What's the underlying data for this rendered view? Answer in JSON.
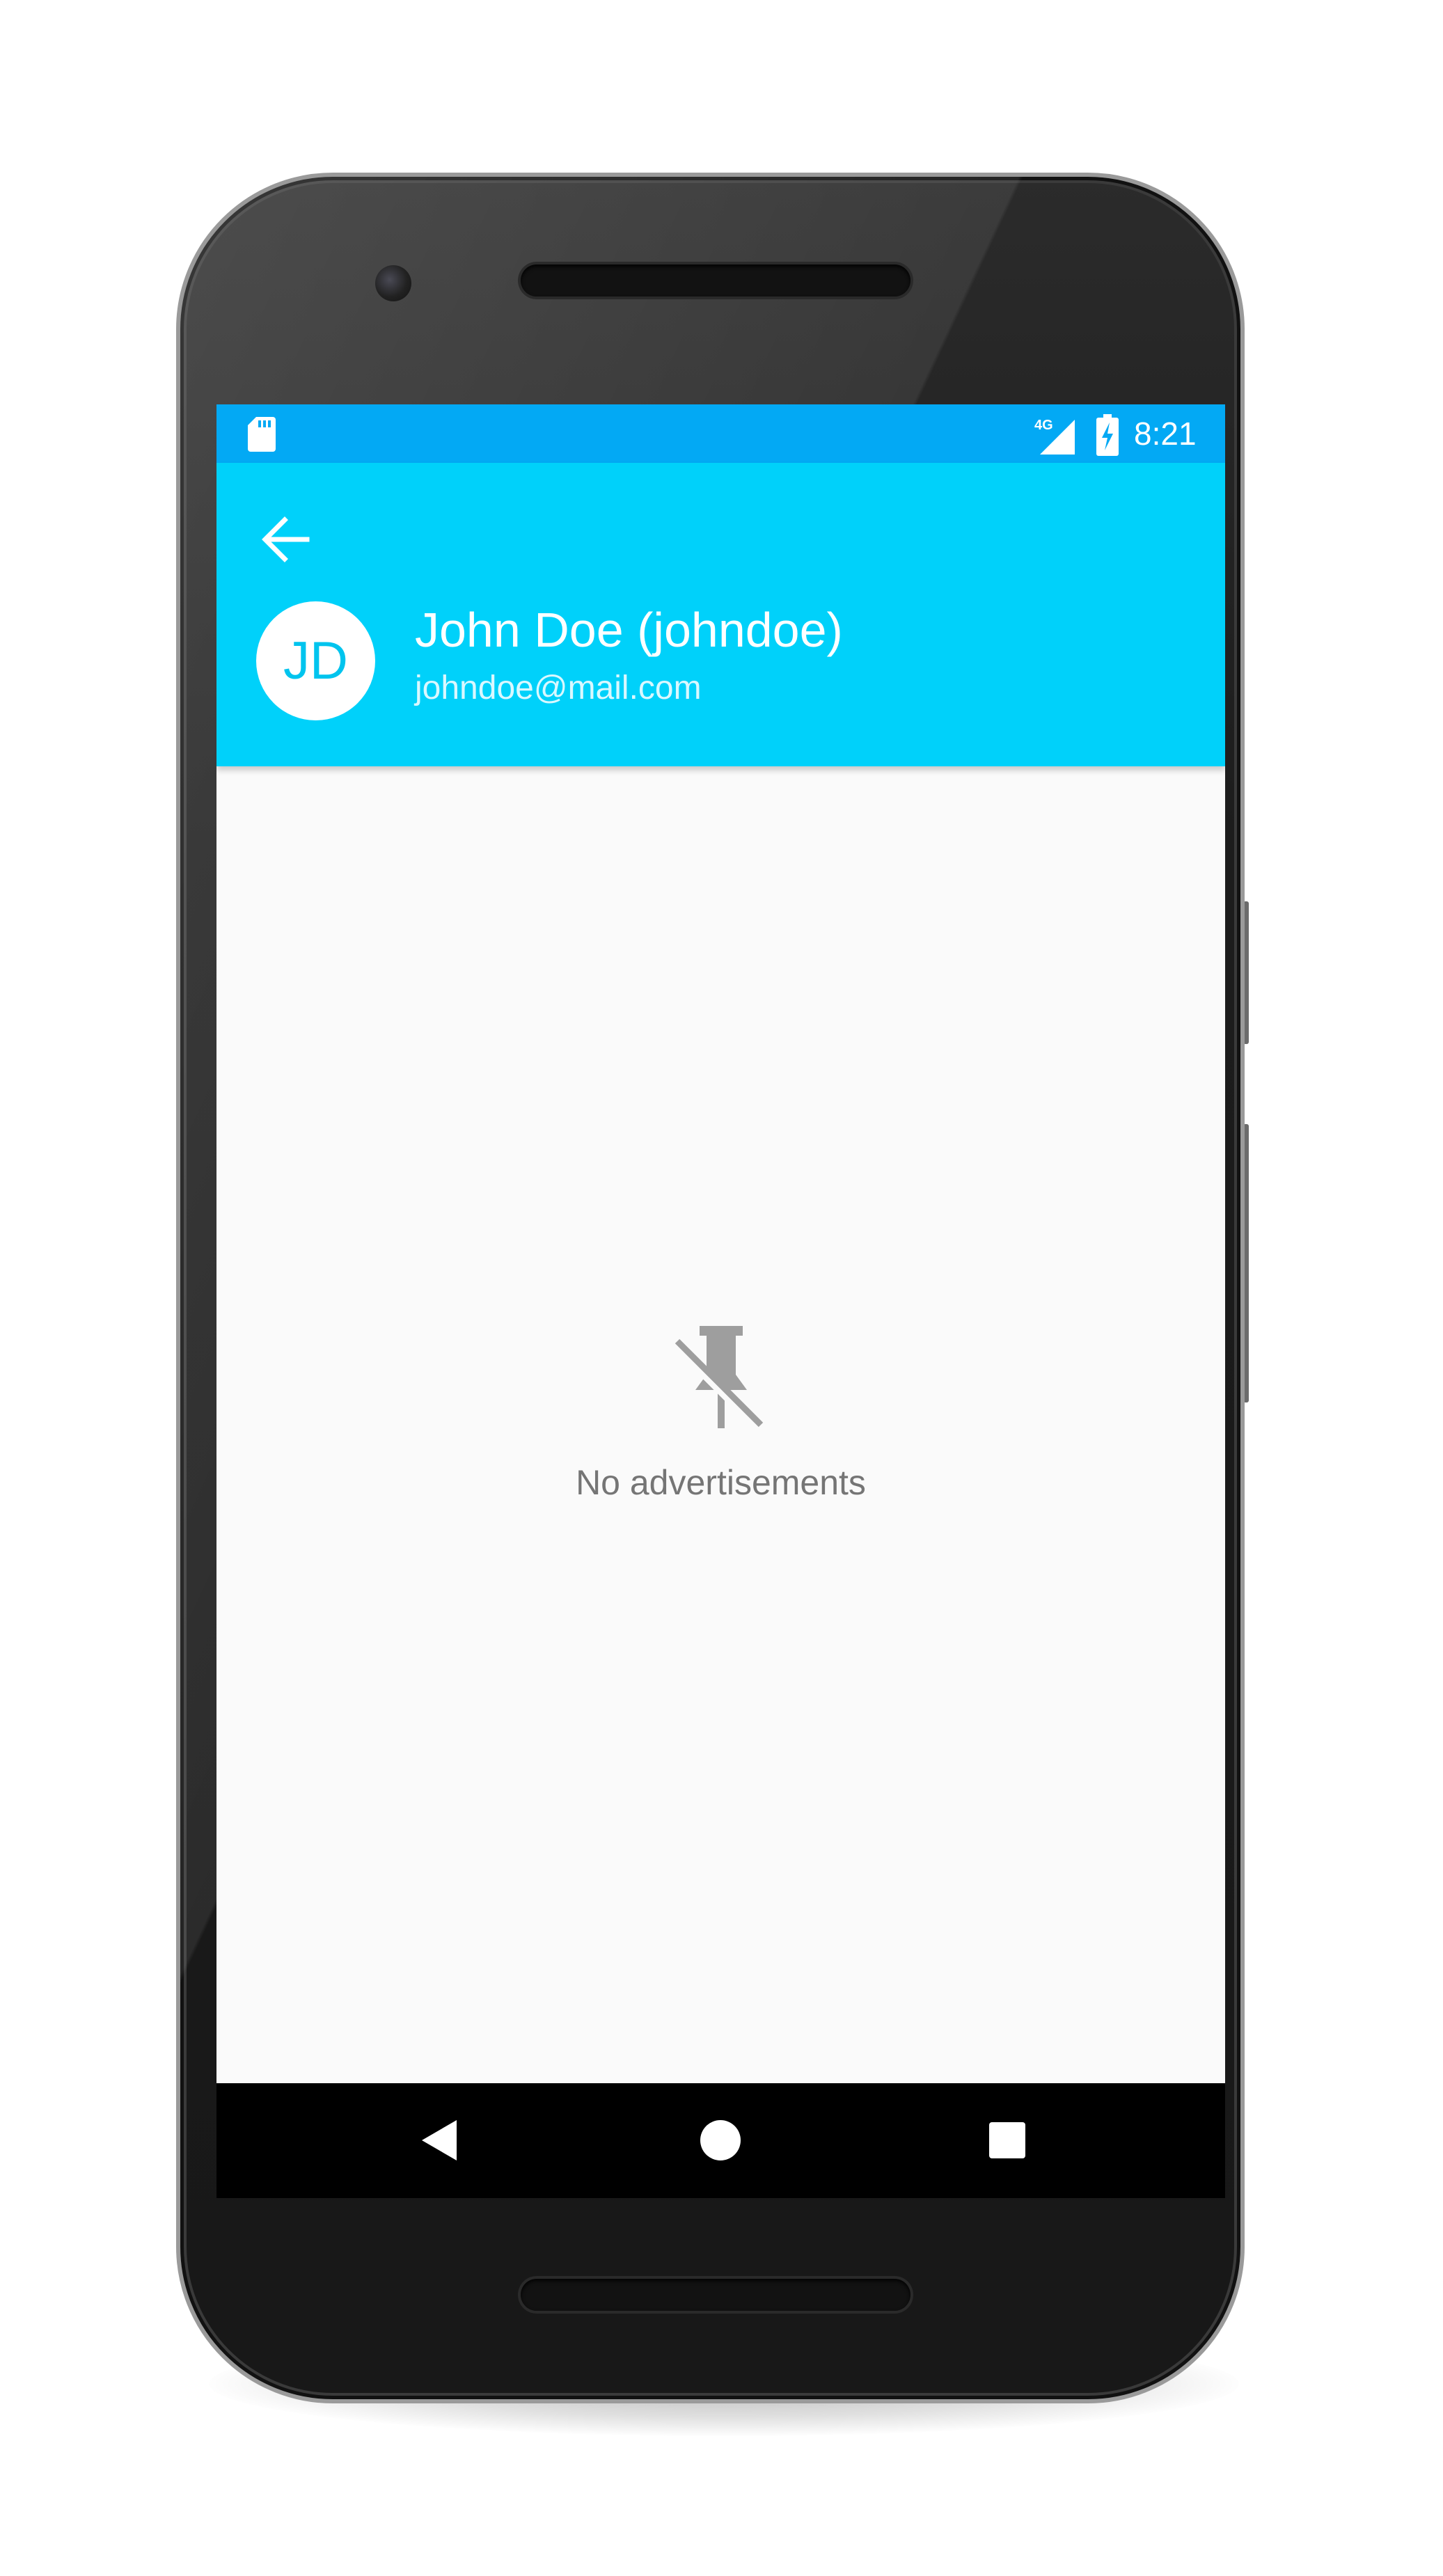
{
  "status_bar": {
    "time": "8:21",
    "network": "4G",
    "left_icon": "sd-card-icon",
    "signal_icon": "signal-icon",
    "battery_icon": "battery-charging-icon"
  },
  "app_bar": {
    "back_icon": "arrow-back-icon",
    "avatar_initials": "JD",
    "user_name": "John Doe (johndoe)",
    "user_email": "johndoe@mail.com"
  },
  "content": {
    "empty_icon": "pin-off-icon",
    "empty_message": "No advertisements"
  },
  "nav_bar": {
    "back_icon": "nav-back-icon",
    "home_icon": "nav-home-icon",
    "recents_icon": "nav-recents-icon"
  },
  "colors": {
    "status_bar": "#03a9f4",
    "app_bar": "#00d1fa",
    "background": "#fafafa",
    "empty_text": "#757575",
    "empty_icon": "#9e9e9e"
  }
}
